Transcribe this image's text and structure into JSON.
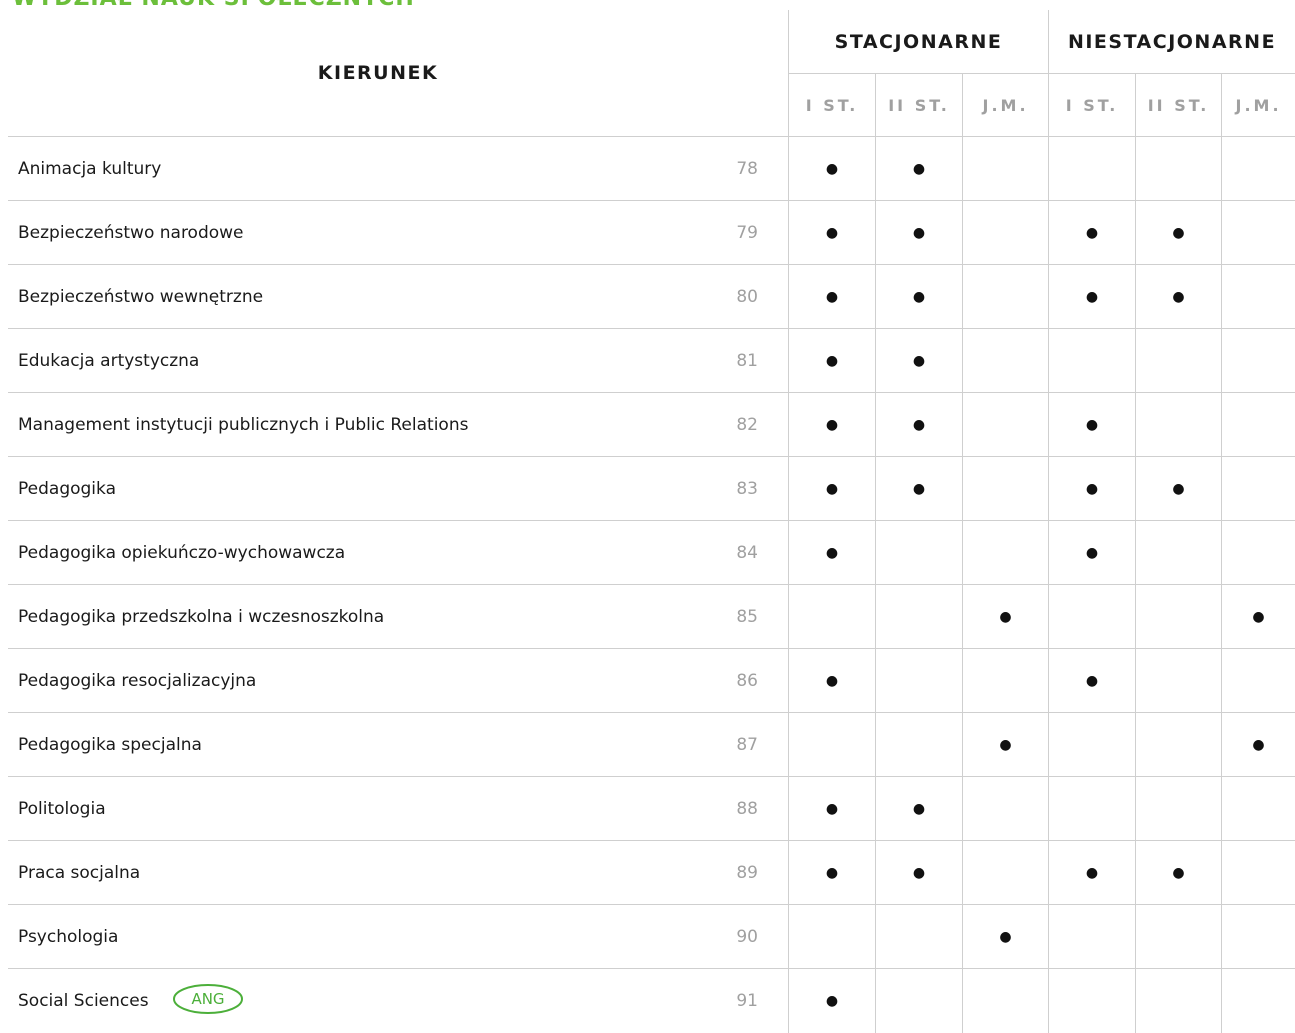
{
  "page_title": "WYDZIAŁ NAUK SPOŁECZNYCH",
  "header": {
    "main": "KIERUNEK",
    "groups": [
      "STACJONARNE",
      "NIESTACJONARNE"
    ],
    "subs": [
      "I ST.",
      "II ST.",
      "J.M.",
      "I ST.",
      "II ST.",
      "J.M."
    ]
  },
  "marker": "●",
  "badge": "ANG",
  "badge_color": "#4caf3a",
  "accent_color": "#6cbf3b",
  "rows": [
    {
      "name": "Animacja kultury",
      "page": "78",
      "marks": [
        1,
        1,
        0,
        0,
        0,
        0
      ]
    },
    {
      "name": "Bezpieczeństwo narodowe",
      "page": "79",
      "marks": [
        1,
        1,
        0,
        1,
        1,
        0
      ]
    },
    {
      "name": "Bezpieczeństwo wewnętrzne",
      "page": "80",
      "marks": [
        1,
        1,
        0,
        1,
        1,
        0
      ]
    },
    {
      "name": "Edukacja artystyczna",
      "page": "81",
      "marks": [
        1,
        1,
        0,
        0,
        0,
        0
      ]
    },
    {
      "name": "Management instytucji publicznych i Public Relations",
      "page": "82",
      "marks": [
        1,
        1,
        0,
        1,
        0,
        0
      ]
    },
    {
      "name": "Pedagogika",
      "page": "83",
      "marks": [
        1,
        1,
        0,
        1,
        1,
        0
      ]
    },
    {
      "name": "Pedagogika opiekuńczo-wychowawcza",
      "page": "84",
      "marks": [
        1,
        0,
        0,
        1,
        0,
        0
      ]
    },
    {
      "name": "Pedagogika przedszkolna i wczesnoszkolna",
      "page": "85",
      "marks": [
        0,
        0,
        1,
        0,
        0,
        1
      ]
    },
    {
      "name": "Pedagogika resocjalizacyjna",
      "page": "86",
      "marks": [
        1,
        0,
        0,
        1,
        0,
        0
      ]
    },
    {
      "name": "Pedagogika specjalna",
      "page": "87",
      "marks": [
        0,
        0,
        1,
        0,
        0,
        1
      ]
    },
    {
      "name": "Politologia",
      "page": "88",
      "marks": [
        1,
        1,
        0,
        0,
        0,
        0
      ]
    },
    {
      "name": "Praca socjalna",
      "page": "89",
      "marks": [
        1,
        1,
        0,
        1,
        1,
        0
      ]
    },
    {
      "name": "Psychologia",
      "page": "90",
      "marks": [
        0,
        0,
        1,
        0,
        0,
        0
      ]
    },
    {
      "name": "Social Sciences",
      "page": "91",
      "marks": [
        1,
        0,
        0,
        0,
        0,
        0
      ],
      "badge": true
    }
  ]
}
